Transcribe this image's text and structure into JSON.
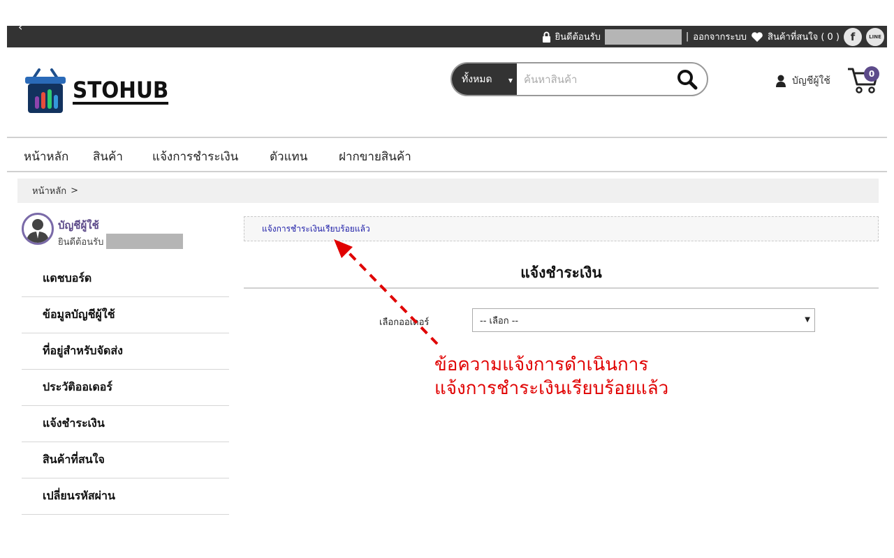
{
  "topbar": {
    "back_glyph": "‹",
    "welcome": "ยินดีต้อนรับ",
    "separator": "|",
    "logout": "ออกจากระบบ",
    "wishlist": "สินค้าที่สนใจ ( 0 )",
    "facebook_glyph": "f",
    "line_glyph": "LINE"
  },
  "logo": {
    "text": "STOHUB"
  },
  "search": {
    "category": "ทั้งหมด",
    "placeholder": "ค้นหาสินค้า"
  },
  "account": {
    "label": "บัญชีผู้ใช้"
  },
  "cart": {
    "count": "0"
  },
  "nav": [
    "หน้าหลัก",
    "สินค้า",
    "แจ้งการชำระเงิน",
    "ตัวแทน",
    "ฝากขายสินค้า"
  ],
  "breadcrumb": {
    "home": "หน้าหลัก",
    "sep": ">"
  },
  "profile": {
    "title": "บัญชีผู้ใช้",
    "welcome": "ยินดีต้อนรับ"
  },
  "side_menu": [
    "แดชบอร์ด",
    "ข้อมูลบัญชีผู้ใช้",
    "ที่อยู่สำหรับจัดส่ง",
    "ประวัติออเดอร์",
    "แจ้งชำระเงิน",
    "สินค้าที่สนใจ",
    "เปลี่ยนรหัสผ่าน"
  ],
  "main": {
    "alert": "แจ้งการชำระเงินเรียบร้อยแล้ว",
    "title": "แจ้งชำระเงิน",
    "order_label": "เลือกออเดอร์",
    "order_select": "-- เลือก --"
  },
  "annotation": {
    "line1": "ข้อความแจ้งการดำเนินการ",
    "line2": "แจ้งการชำระเงินเรียบร้อยแล้ว"
  },
  "colors": {
    "topbar": "#333333",
    "accent": "#5d4b8a",
    "annotation": "#e00000",
    "alert_text": "#1a1aa6"
  }
}
